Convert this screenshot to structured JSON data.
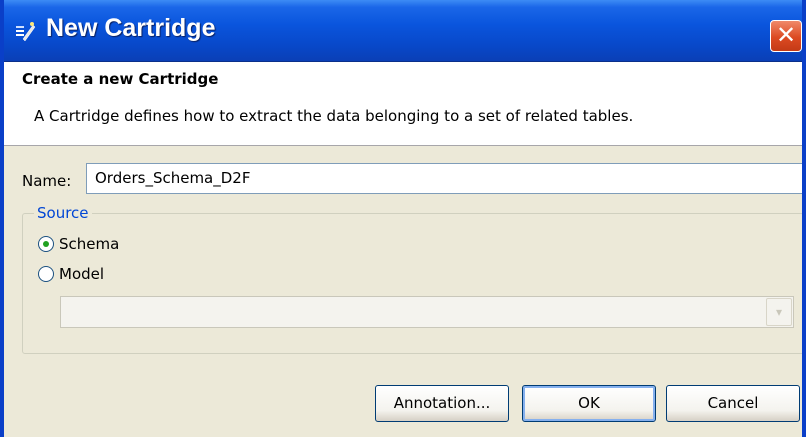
{
  "window": {
    "title": "New Cartridge",
    "close_glyph": "✕"
  },
  "banner": {
    "title": "Create a new Cartridge",
    "description": "A Cartridge defines how to extract the data belonging to a set of related tables."
  },
  "form": {
    "name_label": "Name:",
    "name_value": "Orders_Schema_D2F",
    "source_group_label": "Source",
    "source_options": [
      {
        "label": "Schema",
        "checked": true
      },
      {
        "label": "Model",
        "checked": false
      }
    ],
    "model_select_value": "",
    "model_select_enabled": false,
    "combo_arrow": "▾"
  },
  "buttons": {
    "annotation": "Annotation...",
    "ok": "OK",
    "cancel": "Cancel"
  },
  "colors": {
    "titlebar": "#0a55dd",
    "close_button": "#dc4a22",
    "group_label": "#0046d5",
    "dialog_background": "#ece9d8"
  }
}
